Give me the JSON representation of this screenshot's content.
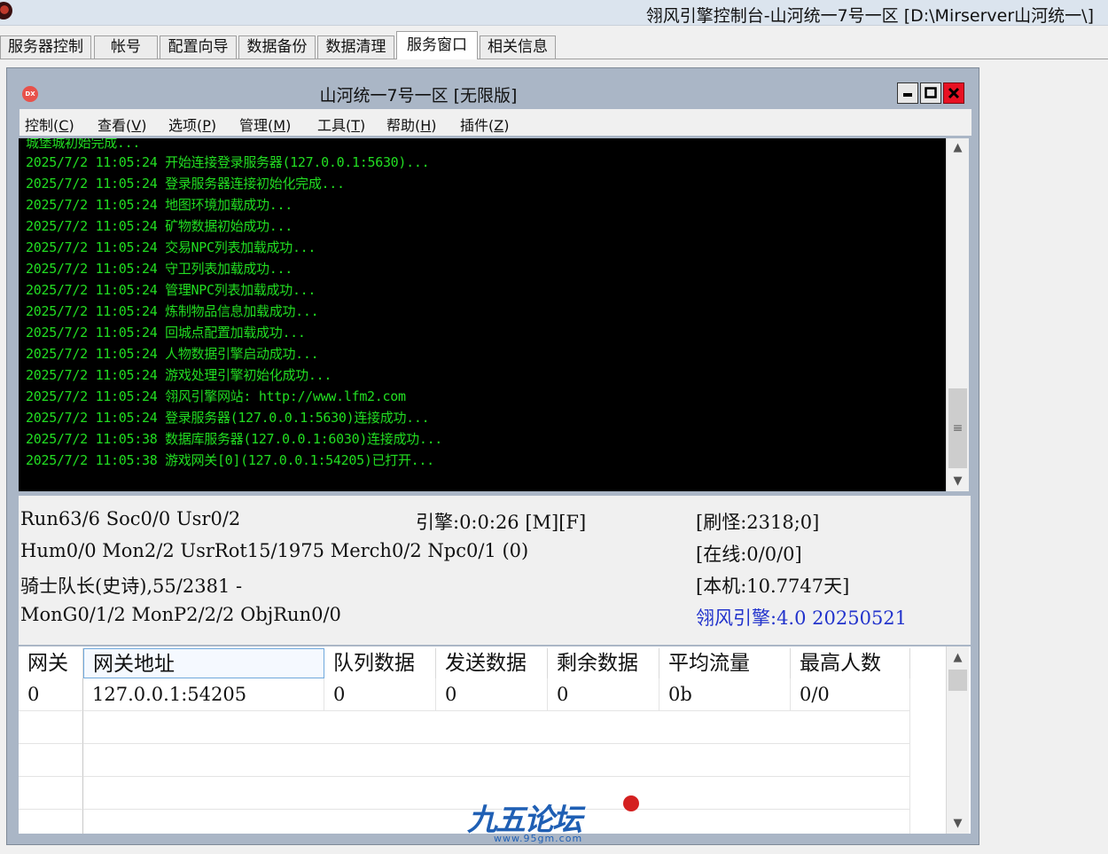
{
  "app": {
    "title": "翎风引擎控制台-山河统一7号一区 [D:\\Mirserver山河统一\\]"
  },
  "tabs": [
    {
      "label": "服务器控制"
    },
    {
      "label": "帐号"
    },
    {
      "label": "配置向导"
    },
    {
      "label": "数据备份"
    },
    {
      "label": "数据清理"
    },
    {
      "label": "服务窗口",
      "active": true
    },
    {
      "label": "相关信息"
    }
  ],
  "window": {
    "title": "山河统一7号一区 [无限版]",
    "icon_text": "DX",
    "minimize_icon": "minimize-icon",
    "maximize_icon": "maximize-icon",
    "close_icon": "close-icon"
  },
  "menu": [
    {
      "label": "控制",
      "key": "C"
    },
    {
      "label": "查看",
      "key": "V"
    },
    {
      "label": "选项",
      "key": "P"
    },
    {
      "label": "管理",
      "key": "M"
    },
    {
      "label": "工具",
      "key": "T"
    },
    {
      "label": "帮助",
      "key": "H"
    },
    {
      "label": "插件",
      "key": "Z"
    }
  ],
  "log": [
    "城堡城初始完成...",
    "2025/7/2 11:05:24 开始连接登录服务器(127.0.0.1:5630)...",
    "2025/7/2 11:05:24 登录服务器连接初始化完成...",
    "2025/7/2 11:05:24 地图环境加载成功...",
    "2025/7/2 11:05:24 矿物数据初始成功...",
    "2025/7/2 11:05:24 交易NPC列表加载成功...",
    "2025/7/2 11:05:24 守卫列表加载成功...",
    "2025/7/2 11:05:24 管理NPC列表加载成功...",
    "2025/7/2 11:05:24 炼制物品信息加载成功...",
    "2025/7/2 11:05:24 回城点配置加载成功...",
    "2025/7/2 11:05:24 人物数据引擎启动成功...",
    "2025/7/2 11:05:24 游戏处理引擎初始化成功...",
    "2025/7/2 11:05:24 翎风引擎网站: http://www.lfm2.com",
    "2025/7/2 11:05:24 登录服务器(127.0.0.1:5630)连接成功...",
    "2025/7/2 11:05:38 数据库服务器(127.0.0.1:6030)连接成功...",
    "2025/7/2 11:05:38 游戏网关[0](127.0.0.1:54205)已打开..."
  ],
  "status": {
    "line1_left": "Run63/6 Soc0/0 Usr0/2",
    "line1_mid": "引擎:0:0:26 [M][F]",
    "line1_right": "[刷怪:2318;0]",
    "line2_left": "Hum0/0 Mon2/2 UsrRot15/1975 Merch0/2 Npc0/1 (0)",
    "line2_right": "[在线:0/0/0]",
    "line3_left": "骑士队长(史诗),55/2381 -",
    "line3_right": "[本机:10.7747天]",
    "line4_left": "MonG0/1/2 MonP2/2/2 ObjRun0/0",
    "line4_right": "翎风引擎:4.0 20250521",
    "accent_color": "#2233cc"
  },
  "gateway_table": {
    "headers": [
      "网关",
      "网关地址",
      "队列数据",
      "发送数据",
      "剩余数据",
      "平均流量",
      "最高人数"
    ],
    "rows": [
      [
        "0",
        "127.0.0.1:54205",
        "0",
        "0",
        "0",
        "0b",
        "0/0"
      ],
      [
        "",
        "",
        "",
        "",
        "",
        "",
        ""
      ],
      [
        "",
        "",
        "",
        "",
        "",
        "",
        ""
      ],
      [
        "",
        "",
        "",
        "",
        "",
        "",
        ""
      ],
      [
        "",
        "",
        "",
        "",
        "",
        "",
        ""
      ]
    ]
  },
  "watermark": {
    "text": "九五论坛",
    "sub": "www.95gm.com"
  },
  "scroll_icons": {
    "up": "▲",
    "down": "▼",
    "grip": "≡"
  }
}
